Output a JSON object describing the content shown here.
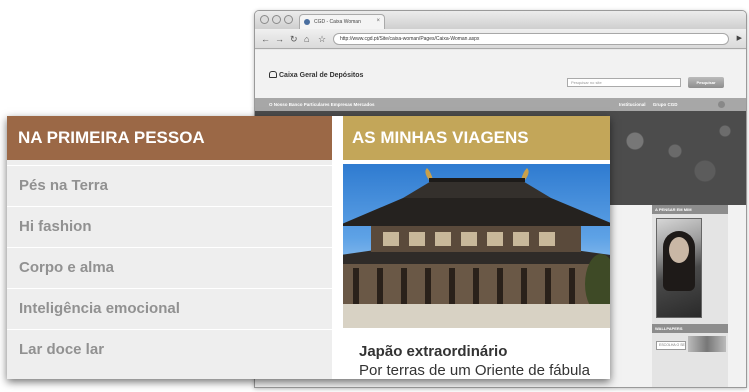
{
  "browser": {
    "tab_title": "CGD - Caixa Woman",
    "url": "http://www.cgd.pt/Site/caixa-woman/Pages/Caixa-Woman.aspx"
  },
  "website": {
    "logo_text": "Caixa Geral de Depósitos",
    "search_placeholder": "Pesquisar no site",
    "search_button": "Pesquisar",
    "nav_left": "O Nosso Banco   Particulares   Empresas   Mercados",
    "nav_right": [
      "Institucional",
      "Grupo CGD"
    ],
    "side_head_1": "A PENSAR EM MIM",
    "side_head_2": "WALLPAPERS",
    "wallpaper_button": "ESCOLHA O SEU"
  },
  "panel": {
    "left_heading": "NA PRIMEIRA PESSOA",
    "left_items": [
      "Pés na Terra",
      "Hi fashion",
      "Corpo e alma",
      "Inteligência emocional",
      "Lar doce lar"
    ],
    "right_heading": "AS MINHAS VIAGENS",
    "article_title": "Japão extraordinário",
    "article_subtitle": "Por terras de um Oriente de fábula"
  },
  "colors": {
    "left_heading_bg": "#9b6846",
    "right_heading_bg": "#c3a659",
    "menu_text": "#919191"
  }
}
